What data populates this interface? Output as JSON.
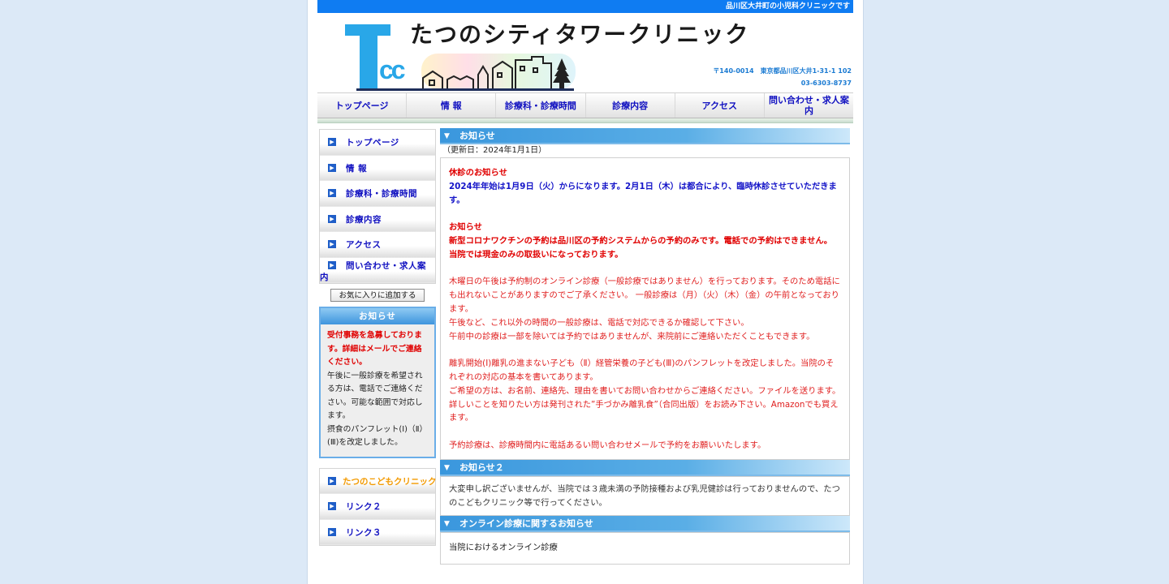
{
  "topbar": {
    "tagline": "品川区大井町の小児科クリニックです"
  },
  "header": {
    "logo_text": "Tcc",
    "title": "たつのシティタワークリニック",
    "address": "〒140-0014　東京都品川区大井1-31-1 102",
    "phone": "03-6303-8737"
  },
  "nav": [
    {
      "label": "トップページ"
    },
    {
      "label": "情 報"
    },
    {
      "label": "診療科・診療時間"
    },
    {
      "label": "診療内容"
    },
    {
      "label": "アクセス"
    },
    {
      "label": "問い合わせ・求人案内"
    }
  ],
  "sidebar": {
    "menu": [
      {
        "label": "トップページ"
      },
      {
        "label": "情 報"
      },
      {
        "label": "診療科・診療時間"
      },
      {
        "label": "診療内容"
      },
      {
        "label": "アクセス"
      },
      {
        "label": "問い合わせ・求人案内"
      }
    ],
    "favorite_button": "お気に入りに追加する",
    "notice": {
      "title": "お知らせ",
      "highlight": "受付事務を急募しております。詳細はメールでご連絡ください。",
      "body1": "午後に一般診療を希望される方は、電話でご連絡ください。可能な範囲で対応します。",
      "body2": "摂食のパンフレット(Ⅰ)（Ⅱ）(Ⅲ)を改定しました。"
    },
    "links": [
      {
        "label": "たつのこどもクリニック"
      },
      {
        "label": "リンク２"
      },
      {
        "label": "リンク３"
      }
    ]
  },
  "main": {
    "section1": {
      "title": "お知らせ",
      "updated": "（更新日：2024年1月1日）",
      "closure_title": "休診のお知らせ",
      "closure_text": "2024年年始は1月9日（火）からになります。2月1日（木）は都合により、臨時休診させていただきます。",
      "notice_title": "お知らせ",
      "vaccine_text": "新型コロナワクチンの予約は品川区の予約システムからの予約のみです。電話での予約はできません。",
      "cash_text": "当院では現金のみの取扱いになっております。",
      "online_text": "木曜日の午後は予約制のオンライン診療（一般診療ではありません）を行っております。そのため電話にも出れないことがありますのでご了承ください。 一般診療は（月）（火）（木）（金）の午前となっております。",
      "afternoon_text": "午後など、これ以外の時間の一般診療は、電話で対応できるか確認して下さい。",
      "morning_text": "午前中の診療は一部を除いては予約ではありませんが、来院前にご連絡いただくこともできます。",
      "pamphlet_text": "離乳開始(Ⅰ)離乳の進まない子ども（Ⅱ）経管栄養の子ども(Ⅲ)のパンフレットを改定しました。当院のそれぞれの対応の基本を書いてあります。",
      "request_text": "ご希望の方は、お名前、連絡先、理由を書いてお問い合わせからご連絡ください。ファイルを送ります。",
      "book_text": "詳しいことを知りたい方は発刊された”手づかみ離乳食”（合同出版）をお読み下さい。Amazonでも買えます。",
      "appointment_text": "予約診療は、診療時間内に電話あるい問い合わせメールで予約をお願いいたします。"
    },
    "section2": {
      "title": "お知らせ２",
      "text": "大変申し訳ございませんが、当院では３歳未満の予防接種および乳児健診は行っておりませんので、たつのこどもクリニック等で行ってください。"
    },
    "section3": {
      "title": "オンライン診療に関するお知らせ",
      "text": "当院におけるオンライン診療"
    }
  },
  "colors": {
    "accent_blue": "#0f7cf2",
    "logo_blue": "#29a7e8",
    "link_blue": "#1010c0",
    "notice_red": "#e00000",
    "background": "#dce9f7"
  }
}
